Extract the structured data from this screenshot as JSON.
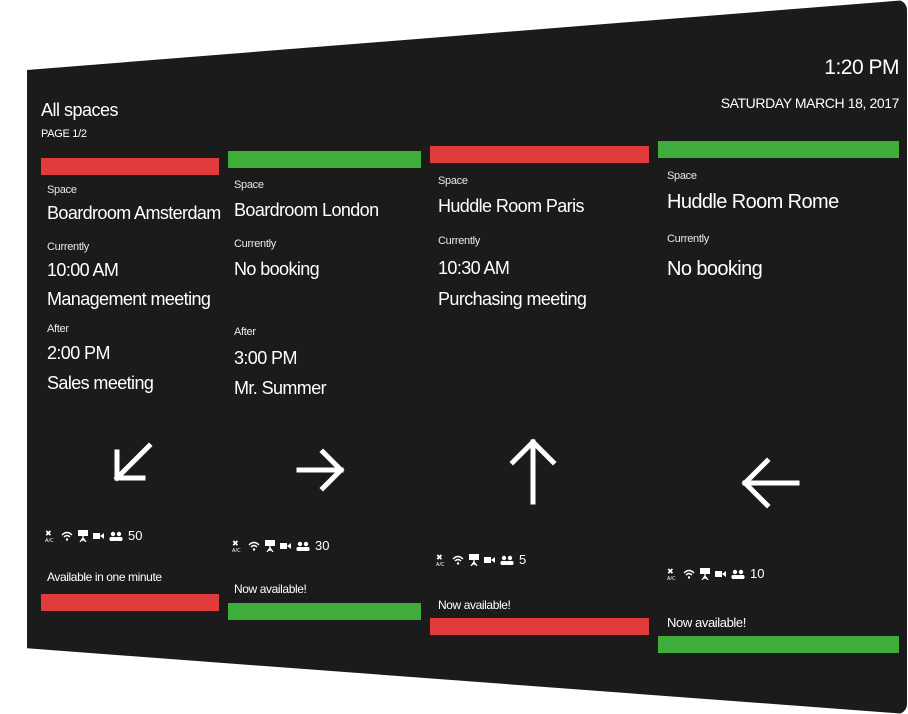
{
  "header": {
    "title": "All spaces",
    "page": "PAGE 1/2",
    "time": "1:20 PM",
    "date": "SATURDAY MARCH 18, 2017"
  },
  "labels": {
    "space": "Space",
    "currently": "Currently",
    "after": "After"
  },
  "colors": {
    "busy": "#e23b3b",
    "free": "#3fad3a",
    "screen": "#1b1b1b"
  },
  "rooms": [
    {
      "name": "Boardroom Amsterdam",
      "status_color": "red",
      "current_time": "10:00 AM",
      "current_title": "Management meeting",
      "after_time": "2:00 PM",
      "after_title": "Sales meeting",
      "direction": "down-left-arrow-icon",
      "capacity": "50",
      "availability": "Available in one minute"
    },
    {
      "name": "Boardroom London",
      "status_color": "green",
      "current_time": "No booking",
      "current_title": "",
      "after_time": "3:00 PM",
      "after_title": "Mr. Summer",
      "direction": "right-arrow-icon",
      "capacity": "30",
      "availability": "Now available!"
    },
    {
      "name": "Huddle Room Paris",
      "status_color": "red",
      "current_time": "10:30 AM",
      "current_title": "Purchasing meeting",
      "after_time": "",
      "after_title": "",
      "direction": "up-arrow-icon",
      "capacity": "5",
      "availability": "Now available!"
    },
    {
      "name": "Huddle Room Rome",
      "status_color": "green",
      "current_time": "No booking",
      "current_title": "",
      "after_time": "",
      "after_title": "",
      "direction": "left-arrow-icon",
      "capacity": "10",
      "availability": "Now available!"
    }
  ],
  "amenity_icons": [
    "ac-icon",
    "wifi-icon",
    "projector-icon",
    "camera-icon",
    "people-icon"
  ]
}
